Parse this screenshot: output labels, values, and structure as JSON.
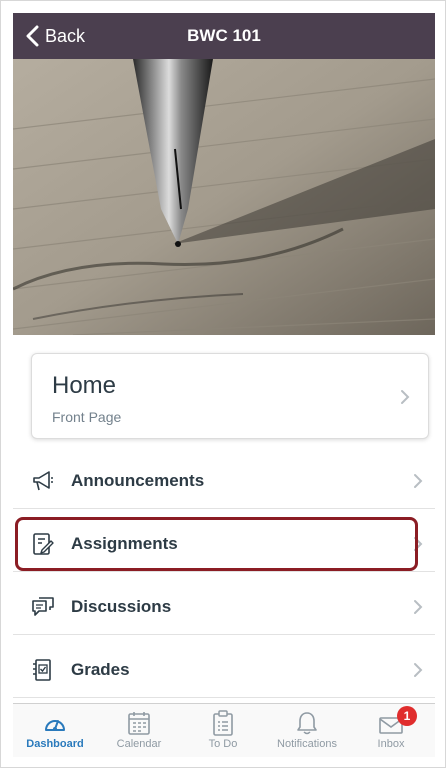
{
  "nav": {
    "back_label": "Back",
    "title": "BWC 101"
  },
  "home_card": {
    "title": "Home",
    "subtitle": "Front Page"
  },
  "menu": {
    "items": [
      {
        "label": "Announcements",
        "icon": "megaphone-icon"
      },
      {
        "label": "Assignments",
        "icon": "assignment-icon",
        "highlighted": true
      },
      {
        "label": "Discussions",
        "icon": "discussions-icon"
      },
      {
        "label": "Grades",
        "icon": "grades-icon"
      }
    ]
  },
  "tabs": [
    {
      "label": "Dashboard",
      "icon": "dashboard-icon",
      "active": true
    },
    {
      "label": "Calendar",
      "icon": "calendar-icon"
    },
    {
      "label": "To Do",
      "icon": "todo-icon"
    },
    {
      "label": "Notifications",
      "icon": "bell-icon"
    },
    {
      "label": "Inbox",
      "icon": "inbox-icon",
      "badge": "1"
    }
  ],
  "colors": {
    "header": "#4b3f4f",
    "accent": "#2a7abc",
    "highlight_border": "#8b1d24",
    "badge": "#e02d2d"
  }
}
